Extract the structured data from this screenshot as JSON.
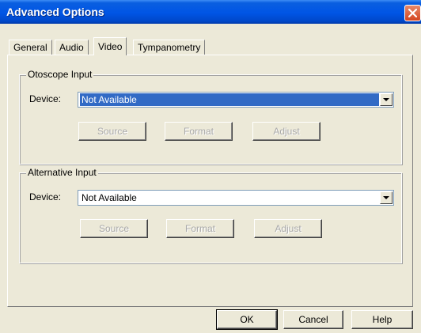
{
  "window": {
    "title": "Advanced Options"
  },
  "tabs": [
    {
      "label": "General",
      "active": false
    },
    {
      "label": "Audio",
      "active": false
    },
    {
      "label": "Video",
      "active": true
    },
    {
      "label": "Tympanometry",
      "active": false
    }
  ],
  "otoscope": {
    "legend": "Otoscope Input",
    "device_label": "Device:",
    "device_value": "Not Available",
    "buttons": {
      "source": "Source",
      "format": "Format",
      "adjust": "Adjust"
    }
  },
  "alternative": {
    "legend": "Alternative Input",
    "device_label": "Device:",
    "device_value": "Not Available",
    "buttons": {
      "source": "Source",
      "format": "Format",
      "adjust": "Adjust"
    }
  },
  "footer": {
    "ok": "OK",
    "cancel": "Cancel",
    "help": "Help"
  },
  "colors": {
    "titlebar": "#0055e5",
    "selection": "#316ac5",
    "face": "#ece9d8"
  }
}
